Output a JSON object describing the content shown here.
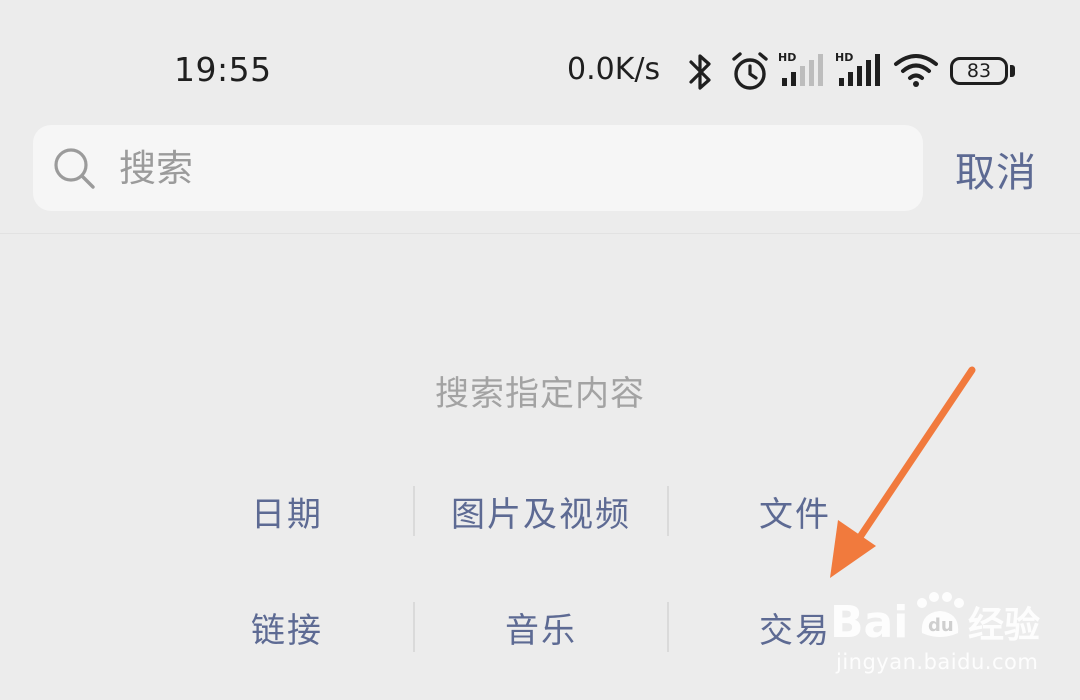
{
  "status_bar": {
    "time": "19:55",
    "network_speed": "0.0K/s",
    "icons": [
      "bluetooth-icon",
      "alarm-icon",
      "hd-signal-icon",
      "hd-signal-icon",
      "wifi-icon"
    ],
    "battery_level": "83"
  },
  "search": {
    "placeholder": "搜索",
    "value": "",
    "cancel_label": "取消"
  },
  "content": {
    "section_title": "搜索指定内容",
    "categories": [
      [
        "日期",
        "图片及视频",
        "文件"
      ],
      [
        "链接",
        "音乐",
        "交易"
      ]
    ]
  },
  "watermark": {
    "label": "jingyan.baidu.com"
  },
  "colors": {
    "background": "#ececec",
    "accent": "#5d6a93",
    "annotation_arrow": "#f17a3d",
    "muted_text": "#a3a3a3"
  }
}
